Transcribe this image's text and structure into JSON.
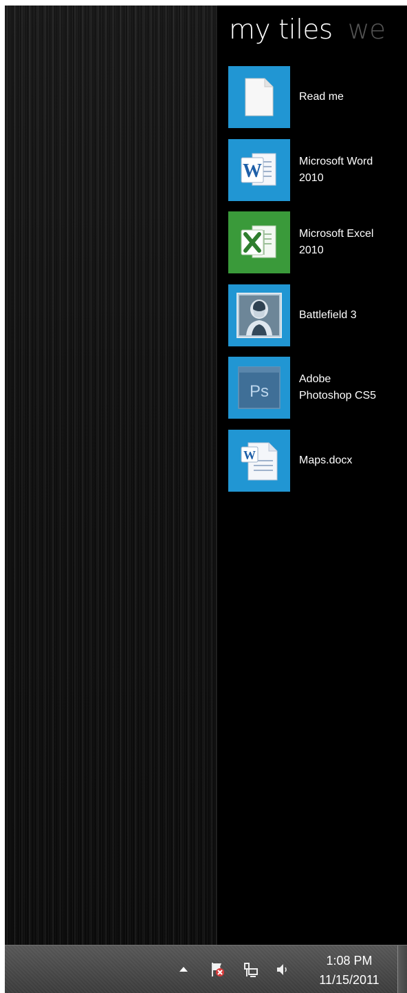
{
  "panel": {
    "tabs": [
      {
        "label": "my tiles"
      },
      {
        "label": "we"
      }
    ]
  },
  "tiles": [
    {
      "label": "Read me",
      "icon": "document-icon",
      "color": "#2196d3"
    },
    {
      "label": "Microsoft Word\n2010",
      "icon": "word-icon",
      "color": "#2196d3"
    },
    {
      "label": "Microsoft Excel\n2010",
      "icon": "excel-icon",
      "color": "#3a9a3a"
    },
    {
      "label": "Battlefield 3",
      "icon": "battlefield-icon",
      "color": "#2196d3"
    },
    {
      "label": "Adobe\nPhotoshop CS5",
      "icon": "photoshop-icon",
      "color": "#2196d3"
    },
    {
      "label": "Maps.docx",
      "icon": "word-document-icon",
      "color": "#2196d3"
    }
  ],
  "photoshop_icon_text": "Ps",
  "word_icon_text": "W",
  "taskbar": {
    "time": "1:08 PM",
    "date": "11/15/2011",
    "tray_icons": [
      "show-hidden-icons-arrow",
      "action-center-error-icon",
      "network-icon",
      "volume-icon"
    ]
  }
}
